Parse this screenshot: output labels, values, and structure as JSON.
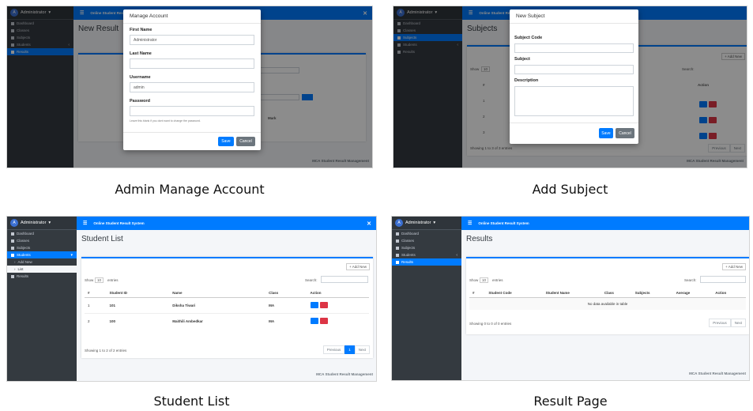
{
  "captions": [
    "Admin Manage Account",
    "Add Subject",
    "Student List",
    "Result Page"
  ],
  "app": {
    "user": "Administrator",
    "avatar_letter": "A",
    "title": "Online Student Result System",
    "footer": "MCA Student Result Management"
  },
  "sidebar": {
    "dashboard": "Dashboard",
    "classes": "Classes",
    "subjects": "Subjects",
    "students": "Students",
    "results": "Results",
    "add_new": "Add New",
    "list": "List"
  },
  "panel1": {
    "page_title": "New Result",
    "bg_column": "Mark",
    "modal": {
      "title": "Manage Account",
      "first_name_label": "First Name",
      "first_name_value": "Administrator",
      "last_name_label": "Last Name",
      "last_name_value": "",
      "username_label": "Username",
      "username_value": "admin",
      "password_label": "Password",
      "password_help": "Leave this blank if you dont want to change the password.",
      "save": "Save",
      "cancel": "Cancel"
    }
  },
  "panel2": {
    "page_title": "Subjects",
    "add_new": "+ Add New",
    "show": "Show",
    "show_value": "10",
    "search": "Search:",
    "col_num": "#",
    "col_action": "Action",
    "rows": [
      "1",
      "2",
      "3"
    ],
    "info": "Showing 1 to 3 of 3 entries",
    "previous": "Previous",
    "next": "Next",
    "modal": {
      "title": "New Subject",
      "code_label": "Subject Code",
      "subject_label": "Subject",
      "description_label": "Description",
      "save": "Save",
      "cancel": "Cancel"
    }
  },
  "panel3": {
    "page_title": "Student List",
    "add_new": "+ Add New",
    "show": "Show",
    "show_value": "10",
    "entries": "entries",
    "search": "Search:",
    "columns": [
      "#",
      "Student ID",
      "Name",
      "Class",
      "Action"
    ],
    "rows": [
      {
        "num": "1",
        "id": "101",
        "name": "Diksha Tiwari",
        "class": "MA"
      },
      {
        "num": "2",
        "id": "100",
        "name": "Maithili Ambedkar",
        "class": "MA"
      }
    ],
    "info": "Showing 1 to 2 of 2 entries",
    "previous": "Previous",
    "page": "1",
    "next": "Next"
  },
  "panel4": {
    "page_title": "Results",
    "add_new": "+ Add New",
    "show": "Show",
    "show_value": "10",
    "entries": "entries",
    "search": "Search:",
    "columns": [
      "#",
      "Student Code",
      "Student Name",
      "Class",
      "Subjects",
      "Average",
      "Action"
    ],
    "empty": "No data available in table",
    "info": "Showing 0 to 0 of 0 entries",
    "previous": "Previous",
    "next": "Next"
  },
  "colors": {
    "primary": "#007bff",
    "danger": "#dc3545",
    "sidebar": "#343a40",
    "secondary": "#6c757d"
  }
}
